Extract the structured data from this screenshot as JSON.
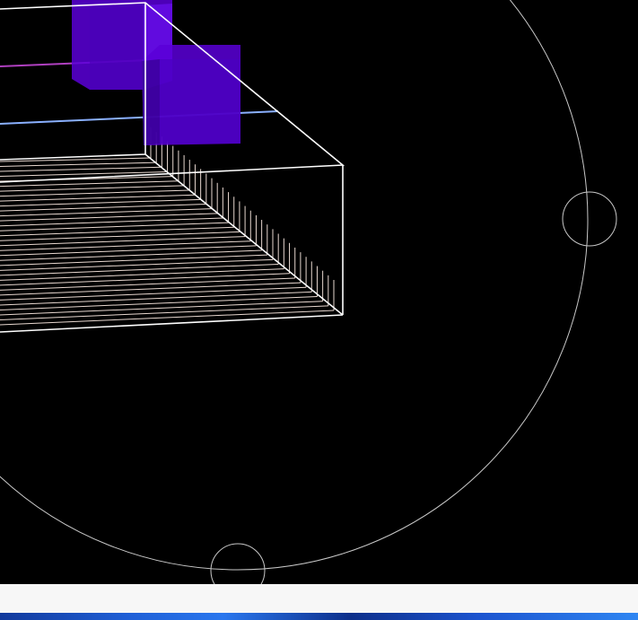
{
  "scene": {
    "background_color": "#000000",
    "bounding_box_color": "#ffffff",
    "lattice_line_color": "#e8d8d0",
    "guide_line_blue": "#8ab0ff",
    "guide_line_magenta": "#b040c0",
    "cube_color": "#5a00d8",
    "rotation_ring_color": "#c8c8c8",
    "objects": [
      {
        "name": "bounding-box",
        "kind": "wireframe box"
      },
      {
        "name": "lattice-lines",
        "kind": "parallel line grid"
      },
      {
        "name": "selection-cube-1",
        "kind": "translucent cube"
      },
      {
        "name": "selection-cube-2",
        "kind": "translucent cube"
      },
      {
        "name": "rotation-ring",
        "kind": "circle"
      },
      {
        "name": "rotation-handle-right",
        "kind": "circle handle"
      },
      {
        "name": "rotation-handle-bottom",
        "kind": "circle handle"
      }
    ]
  },
  "taskbar": {
    "background_color": "#f7f7f7"
  },
  "wallpaper": {
    "colors": [
      "#123a9c",
      "#1f5fd6",
      "#2a77ee",
      "#0d2f8a"
    ]
  }
}
